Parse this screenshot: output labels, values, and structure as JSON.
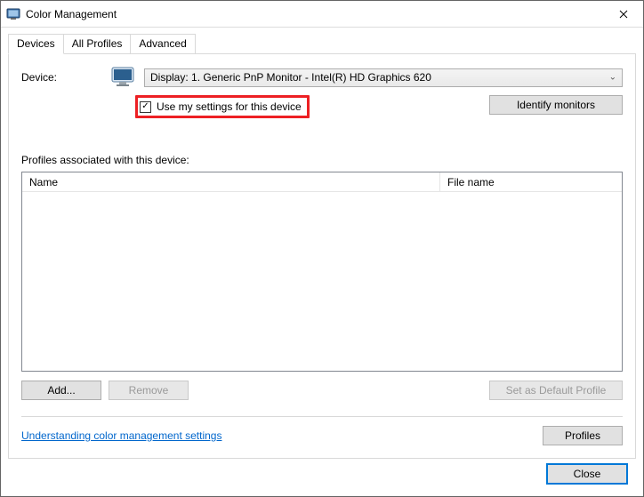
{
  "window": {
    "title": "Color Management"
  },
  "tabs": {
    "devices": "Devices",
    "all_profiles": "All Profiles",
    "advanced": "Advanced"
  },
  "device": {
    "label": "Device:",
    "selected": "Display: 1. Generic PnP Monitor - Intel(R) HD Graphics 620"
  },
  "checkbox": {
    "label": "Use my settings for this device",
    "checked_mark": "✓"
  },
  "buttons": {
    "identify": "Identify monitors",
    "add": "Add...",
    "remove": "Remove",
    "set_default": "Set as Default Profile",
    "profiles": "Profiles",
    "close": "Close"
  },
  "profiles": {
    "caption": "Profiles associated with this device:",
    "col_name": "Name",
    "col_file": "File name"
  },
  "link": {
    "understanding": "Understanding color management settings"
  }
}
